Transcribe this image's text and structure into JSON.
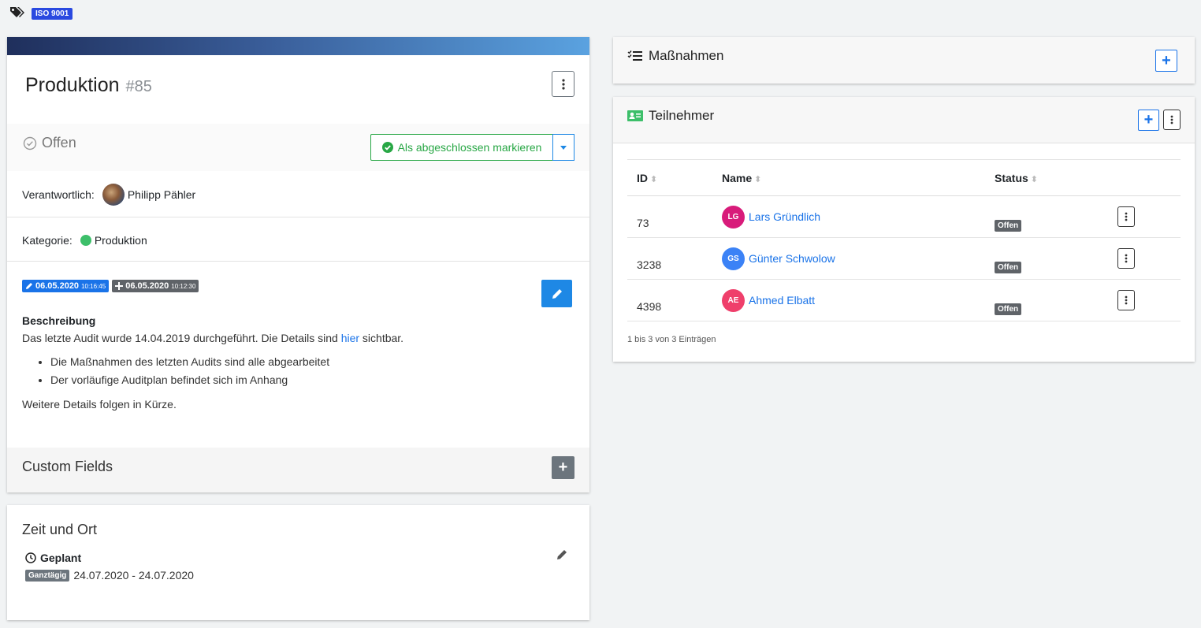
{
  "tags": {
    "icon": "tags-icon",
    "badge": "ISO 9001"
  },
  "header": {
    "title": "Produktion",
    "number": "#85"
  },
  "status": {
    "label": "Offen",
    "complete_button": "Als abgeschlossen markieren"
  },
  "responsible": {
    "label": "Verantwortlich:",
    "name": "Philipp Pähler"
  },
  "category": {
    "label": "Kategorie:",
    "value": "Produktion",
    "color": "#3dbf6a"
  },
  "dates": {
    "edited_date": "06.05.2020",
    "edited_time": "10:16:45",
    "created_date": "06.05.2020",
    "created_time": "10:12:30"
  },
  "description": {
    "heading": "Beschreibung",
    "line1_pre": "Das letzte Audit wurde 14.04.2019 durchgeführt. Die Details sind ",
    "line1_link": "hier",
    "line1_post": " sichtbar.",
    "bullets": [
      "Die Maßnahmen des letzten Audits sind alle abgearbeitet",
      "Der vorläufige Auditplan befindet sich im Anhang"
    ],
    "footer": "Weitere Details folgen in Kürze."
  },
  "custom_fields": {
    "title": "Custom Fields",
    "add": "+"
  },
  "zeit": {
    "title": "Zeit und Ort",
    "planned": "Geplant",
    "allday": "Ganztägig",
    "range": "24.07.2020 - 24.07.2020"
  },
  "massnahmen": {
    "title": "Maßnahmen",
    "add": "+"
  },
  "teilnehmer": {
    "title": "Teilnehmer",
    "add": "+",
    "columns": [
      "ID",
      "Name",
      "Status"
    ],
    "rows": [
      {
        "id": "73",
        "initials": "LG",
        "name": "Lars Gründlich",
        "status": "Offen",
        "color": "#d81b7a"
      },
      {
        "id": "3238",
        "initials": "GS",
        "name": "Günter Schwolow",
        "status": "Offen",
        "color": "#3b82f6"
      },
      {
        "id": "4398",
        "initials": "AE",
        "name": "Ahmed Elbatt",
        "status": "Offen",
        "color": "#ef3f6b"
      }
    ],
    "info": "1 bis 3 von 3 Einträgen"
  }
}
